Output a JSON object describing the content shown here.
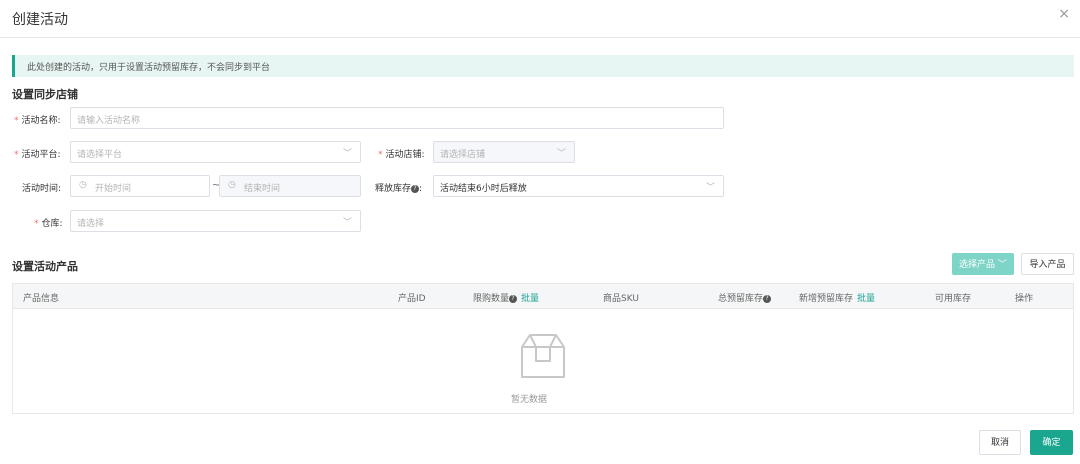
{
  "dialog": {
    "title": "创建活动",
    "close_glyph": "×"
  },
  "notice": "此处创建的活动，只用于设置活动预留库存，不会同步到平台",
  "sections": {
    "store": "设置同步店铺",
    "products": "设置活动产品"
  },
  "form": {
    "name": {
      "label": "活动名称:",
      "placeholder": "请输入活动名称"
    },
    "platform": {
      "label": "活动平台:",
      "placeholder": "请选择平台"
    },
    "store": {
      "label": "活动店铺:",
      "placeholder": "请选择店铺"
    },
    "time": {
      "label": "活动时间:",
      "start_placeholder": "开始时间",
      "separator": "~",
      "end_placeholder": "结束时间"
    },
    "release": {
      "label": "释放库存",
      "value": "活动结束6小时后释放"
    },
    "warehouse": {
      "label": "仓库:",
      "placeholder": "请选择"
    },
    "required_mark": "*"
  },
  "buttons": {
    "select_product": "选择产品",
    "import_product": "导入产品",
    "cancel": "取消",
    "confirm": "确定"
  },
  "table": {
    "columns": {
      "product_info": "产品信息",
      "product_id": "产品ID",
      "limit_qty": "限购数量",
      "batch1": "批量",
      "sku": "商品SKU",
      "total_reserved": "总预留库存",
      "new_reserved": "新增预留库存",
      "batch2": "批量",
      "available": "可用库存",
      "action": "操作"
    },
    "empty": "暂无数据"
  },
  "colors": {
    "accent": "#1aa68f",
    "accent_light": "#7ed4c6",
    "required": "#f56c6c"
  },
  "icons": [
    "close-icon",
    "chevron-down-icon",
    "clock-icon",
    "question-icon",
    "empty-box-icon"
  ]
}
